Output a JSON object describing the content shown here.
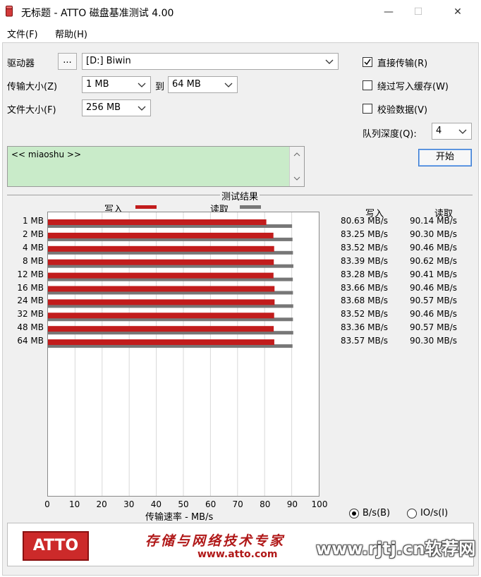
{
  "window": {
    "title": "无标题 - ATTO 磁盘基准测试 4.00",
    "minimize_label": "—",
    "maximize_label": "☐",
    "close_label": "✕"
  },
  "menu": {
    "file": "文件(F)",
    "help": "帮助(H)"
  },
  "settings": {
    "drive_label": "驱动器",
    "browse_label": "...",
    "drive_value": "[D:] Biwin",
    "transfer_size_label": "传输大小(Z)",
    "transfer_from": "1 MB",
    "to_label": "到",
    "transfer_to": "64 MB",
    "file_size_label": "文件大小(F)",
    "file_size": "256 MB",
    "direct_io_label": "直接传输(R)",
    "direct_io_checked": true,
    "bypass_cache_label": "绕过写入缓存(W)",
    "bypass_cache_checked": false,
    "verify_label": "校验数据(V)",
    "verify_checked": false,
    "queue_depth_label": "队列深度(Q):",
    "queue_depth": "4",
    "start_label": "开始"
  },
  "description": {
    "text": "<< miaoshu >>"
  },
  "results": {
    "title": "测试结果",
    "legend_write": "写入",
    "legend_read": "读取",
    "col_write": "写入",
    "col_read": "读取",
    "xlabel": "传输速率 - MB/s",
    "units_bytes": "B/s(B)",
    "units_io": "IO/s(I)",
    "units_selected": "B/s",
    "rows": [
      {
        "size": "1 MB",
        "write": "80.63 MB/s",
        "read": "90.14 MB/s"
      },
      {
        "size": "2 MB",
        "write": "83.25 MB/s",
        "read": "90.30 MB/s"
      },
      {
        "size": "4 MB",
        "write": "83.52 MB/s",
        "read": "90.46 MB/s"
      },
      {
        "size": "8 MB",
        "write": "83.39 MB/s",
        "read": "90.62 MB/s"
      },
      {
        "size": "12 MB",
        "write": "83.28 MB/s",
        "read": "90.41 MB/s"
      },
      {
        "size": "16 MB",
        "write": "83.66 MB/s",
        "read": "90.46 MB/s"
      },
      {
        "size": "24 MB",
        "write": "83.68 MB/s",
        "read": "90.57 MB/s"
      },
      {
        "size": "32 MB",
        "write": "83.52 MB/s",
        "read": "90.46 MB/s"
      },
      {
        "size": "48 MB",
        "write": "83.36 MB/s",
        "read": "90.57 MB/s"
      },
      {
        "size": "64 MB",
        "write": "83.57 MB/s",
        "read": "90.30 MB/s"
      }
    ]
  },
  "chart_data": {
    "type": "bar",
    "orientation": "horizontal",
    "title": "测试结果",
    "xlabel": "传输速率 - MB/s",
    "xlim": [
      0,
      100
    ],
    "x_ticks": [
      0,
      10,
      20,
      30,
      40,
      50,
      60,
      70,
      80,
      90,
      100
    ],
    "categories": [
      "1 MB",
      "2 MB",
      "4 MB",
      "8 MB",
      "12 MB",
      "16 MB",
      "24 MB",
      "32 MB",
      "48 MB",
      "64 MB"
    ],
    "series": [
      {
        "name": "写入",
        "color": "#c21c1c",
        "values": [
          80.63,
          83.25,
          83.52,
          83.39,
          83.28,
          83.66,
          83.68,
          83.52,
          83.36,
          83.57
        ]
      },
      {
        "name": "读取",
        "color": "#777777",
        "values": [
          90.14,
          90.3,
          90.46,
          90.62,
          90.41,
          90.46,
          90.57,
          90.46,
          90.57,
          90.3
        ]
      }
    ],
    "grid": true,
    "legend": "top"
  },
  "footer": {
    "logo_text": "ATTO",
    "slogan": "存储与网络技术专家",
    "url": "www.atto.com",
    "watermark": "www.rjtj.cn软荐网"
  },
  "colors": {
    "write": "#c21c1c",
    "read": "#777777",
    "description_bg": "#c9ebc9",
    "brand": "#cc2a2a"
  }
}
